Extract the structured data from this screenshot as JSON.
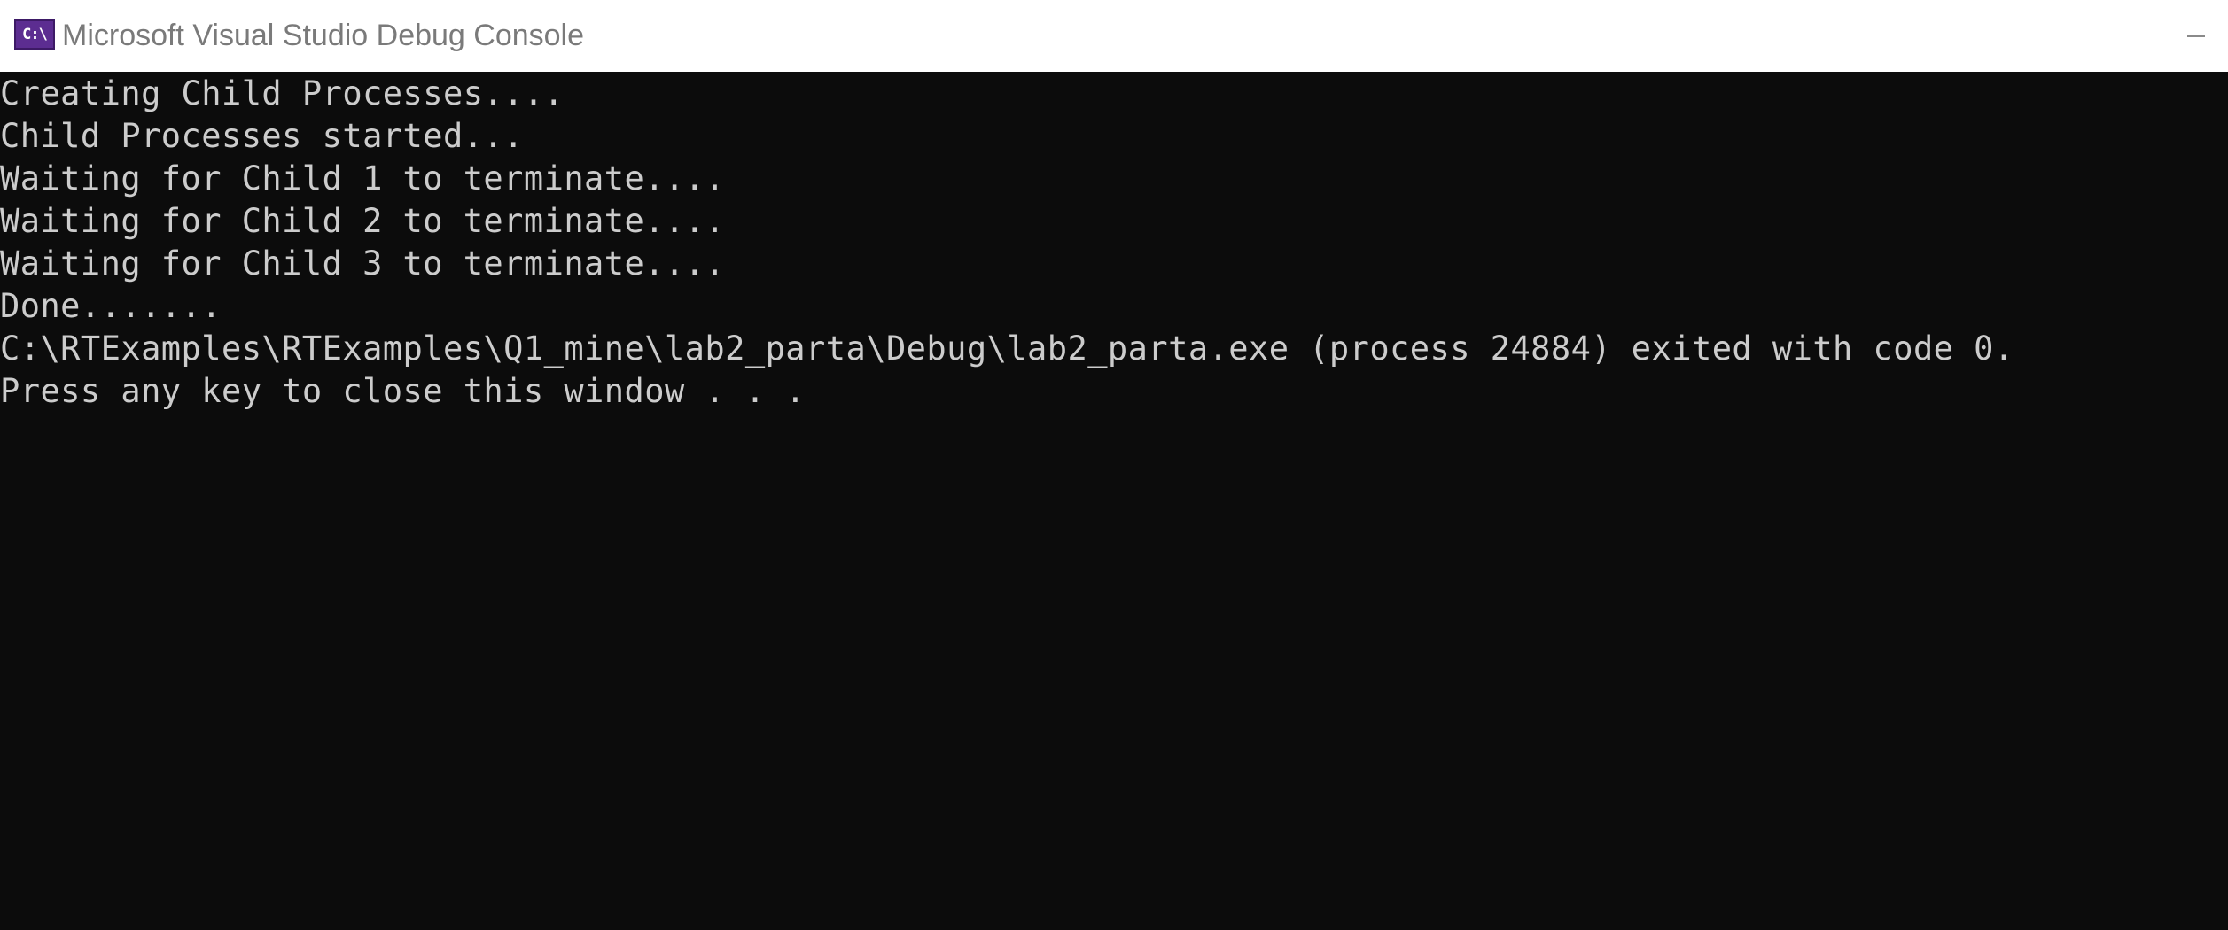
{
  "window": {
    "title": "Microsoft Visual Studio Debug Console",
    "icon_text": "C:\\",
    "icon_name": "console-app-icon",
    "minimize_icon_name": "minimize-icon"
  },
  "console": {
    "lines": [
      "Creating Child Processes....",
      "Child Processes started...",
      "Waiting for Child 1 to terminate....",
      "Waiting for Child 2 to terminate....",
      "Waiting for Child 3 to terminate....",
      "Done.......",
      "C:\\RTExamples\\RTExamples\\Q1_mine\\lab2_parta\\Debug\\lab2_parta.exe (process 24884) exited with code 0.",
      "Press any key to close this window . . ."
    ]
  },
  "colors": {
    "console_background": "#0c0c0c",
    "console_text": "#cccccc",
    "titlebar_background": "#ffffff",
    "title_text": "#7a7a7a",
    "icon_background": "#5c2d91"
  }
}
